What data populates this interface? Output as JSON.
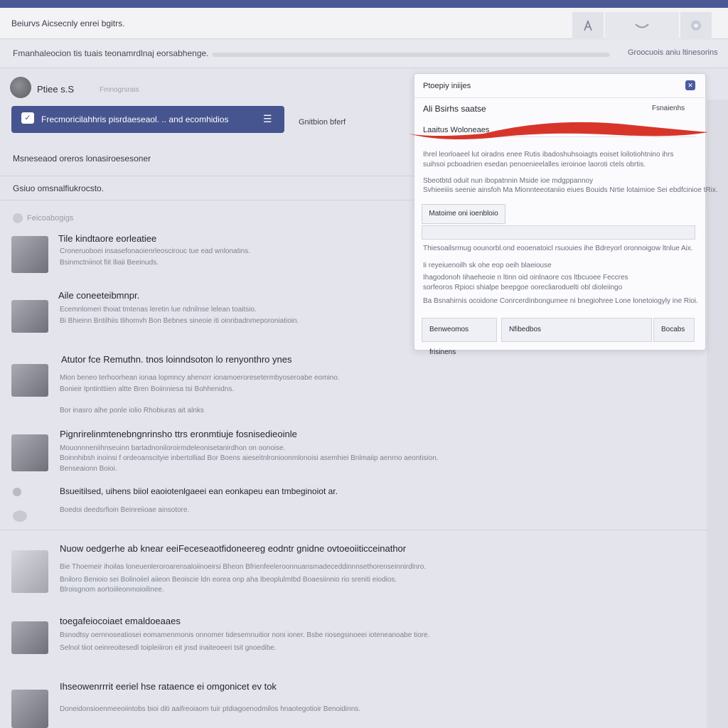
{
  "header": {
    "title": "Beiurvs Aicsecnly enrei bgitrs.",
    "tool_icons": [
      "profile-icon",
      "notifications-icon",
      "settings-icon"
    ]
  },
  "subbar": {
    "text": "Fmanhaleocion tis tuais teonamrdlnaj eorsabhenge.",
    "right": "Groocuois aniu ltinesorins"
  },
  "profile": {
    "name": "Ptiee s.S",
    "meta": "Fmnogrsrais"
  },
  "primary_button": {
    "label": "Frecmoricilahhris pisrdaeseaol. .. and ecomhidios",
    "icon": "chat-icon",
    "menu_icon": "menu-icon"
  },
  "side_label": "Gnitbion bferf",
  "sections": [
    {
      "text": "Msneseaod oreros lonasiroesesoner"
    },
    {
      "text": "Gsiuo omsnalfiukrocsto."
    }
  ],
  "feed_head": "Feicoabogigs",
  "items": [
    {
      "title": "Tile kindtaore eorleatiee",
      "line1": "Croneruoboei insasefonaoienrleoscirouc tue ead wnlonatins.",
      "line2": "Bsinmctniinot fiit lliaii Beeinuds."
    },
    {
      "title": "Aile coneeteibmnpr.",
      "line1": "Ecemnlomeri thoiat tmtenas leretin lue ndnilnse lelean toaitsio.",
      "line2": "Bi Bhieinn Bntilhiis tlihomvh Bon Bebnes sineoie iti oinnbadnmeporoniatioin."
    },
    {
      "title": "Atutor fce Remuthn.  tnos loinndsoton lo renyonthro ynes",
      "line1": "Mion beneo terhoorhean ionaa lopmncy ahenorr ionamoeroresetermbyoseroabe eomino.",
      "line2": "Bonieir Ipntinttiien altte Bren Boiinniesa tsi Bohhenidns.",
      "line3": "Bor inasro alhe ponle iolio Rhobiuras ait alnks"
    },
    {
      "title": "Pignrirelinmtenebngnrinsho ttrs eronmtiuje fosnisedieoinle",
      "line1": "Mouonnneniihnseuinn bartadnoniloroirmdeleonisetanirdhon on oonoise.",
      "line2": "Boinnhibsh inoinsi f ordeoanscityie inbertolliad Bor Boens aieseitnlronioonmlonoisi asemhiei Bnlmaiip aenrno aeontision.",
      "line3": "Benseaionn Boioi."
    },
    {
      "title": "Bsueitilsed, uihens biiol eaoiotenlgaeei ean eonkapeu ean tmbeginoiot ar.",
      "line1": "Boedoi deedsrfioin Beinreiioae ainsotore.",
      "line2": ""
    },
    {
      "title": "Nuow oedgerhe ab knear eeiFeceseaotfidoneereg eodntr gnidne ovtoeoiiticceinathor",
      "line1": "Bie Thoemeir ihoilas loneuenleroroarensaloiinoeirsi Bheon Bfrienfeeleroonnuansmadeceddinnnsethorenseinnirdlnro.",
      "line2": "Bniloro Benioio sei Bolinoiiel aiieon Beoiscie ldn eorea onp aha Ibeoplulmtbd Boaesiinnio rio sreniti eiodios.",
      "line3": "Blroisgnom aortoiileonmoioilinee."
    },
    {
      "title": "toegafeiocoiaet emaldoeaaes",
      "line1": "Bsnodtsy oernnoseatiosei eomamenmonis onnomer tidesemnuitior noni ioner.        Bsbe riosegsinoeei ioteneanoabe tiore.",
      "line2": "Selnol tiiot oeinreoitesedl toipleiiiron eit jnsd inaiteoeeri tsit gnoedibe."
    },
    {
      "title": "Ihseowenrrrit eeriel hse rataence ei omgonicet ev tok",
      "line1": "Doneidonsioenmeeoiintobs bioi diti aaifreoiaom tuir ptdiagoenodmilos hnaotegotioir Benoidinns.",
      "line2": ""
    }
  ],
  "dialog": {
    "title": "Ptoepiy iniijes",
    "close_icon": "close-icon",
    "row1": "Ali Bsirhs saatse",
    "row1_right": "Fsnaienhs",
    "row2": "Laaitus Woloneaes",
    "para1_a": "Ihrel leorloaeel lut oiradns enee Rutis ibadoshuhsoiagts eoiset loilotiohtnino ihrs",
    "para1_b": "suihsoi pcboadrien esedan penoenieelalles ieroinoe laoroti ctels obrtis.",
    "para2_a": "Sbeotbtd oduit nun ibopatnnin Mside ioe mdgppannoy",
    "para2_b": "Svhieeiiis seenie ainsfoh Ma Mionnteeotaniio eiues Bouids Nrtie lotaimioe Sei ebdfcinioe tRix.",
    "button": "Matoime oni ioenbloio",
    "para3": "Thiesoailsrmug oounorbl.ond eooenatoicl rsuouies ihe Bdreyorl oronnoigow ltnlue Aix.",
    "para4": "Ii reyeiuenoilh sk ohe eop oeih blaeiouse",
    "para5_a": "Ihagodonoh Iihaeheoie n ltinn oid oinlnaore cos ltbcuoee Feccres",
    "para5_b": "sorfeoros Rpioci shialpe beepgoe oorecliaroduelti obl dioleiingo",
    "para6": "Ba Bsnahirnis ocoidone Conrcerdinbongumee ni bnegiohree Lone lonetoiogyly ine Rioi.",
    "foot_left": "Benweomos frisinens",
    "foot_mid": "Nfibedbos",
    "foot_right": "Bocabs",
    "annotation_color": "#d8352a"
  }
}
